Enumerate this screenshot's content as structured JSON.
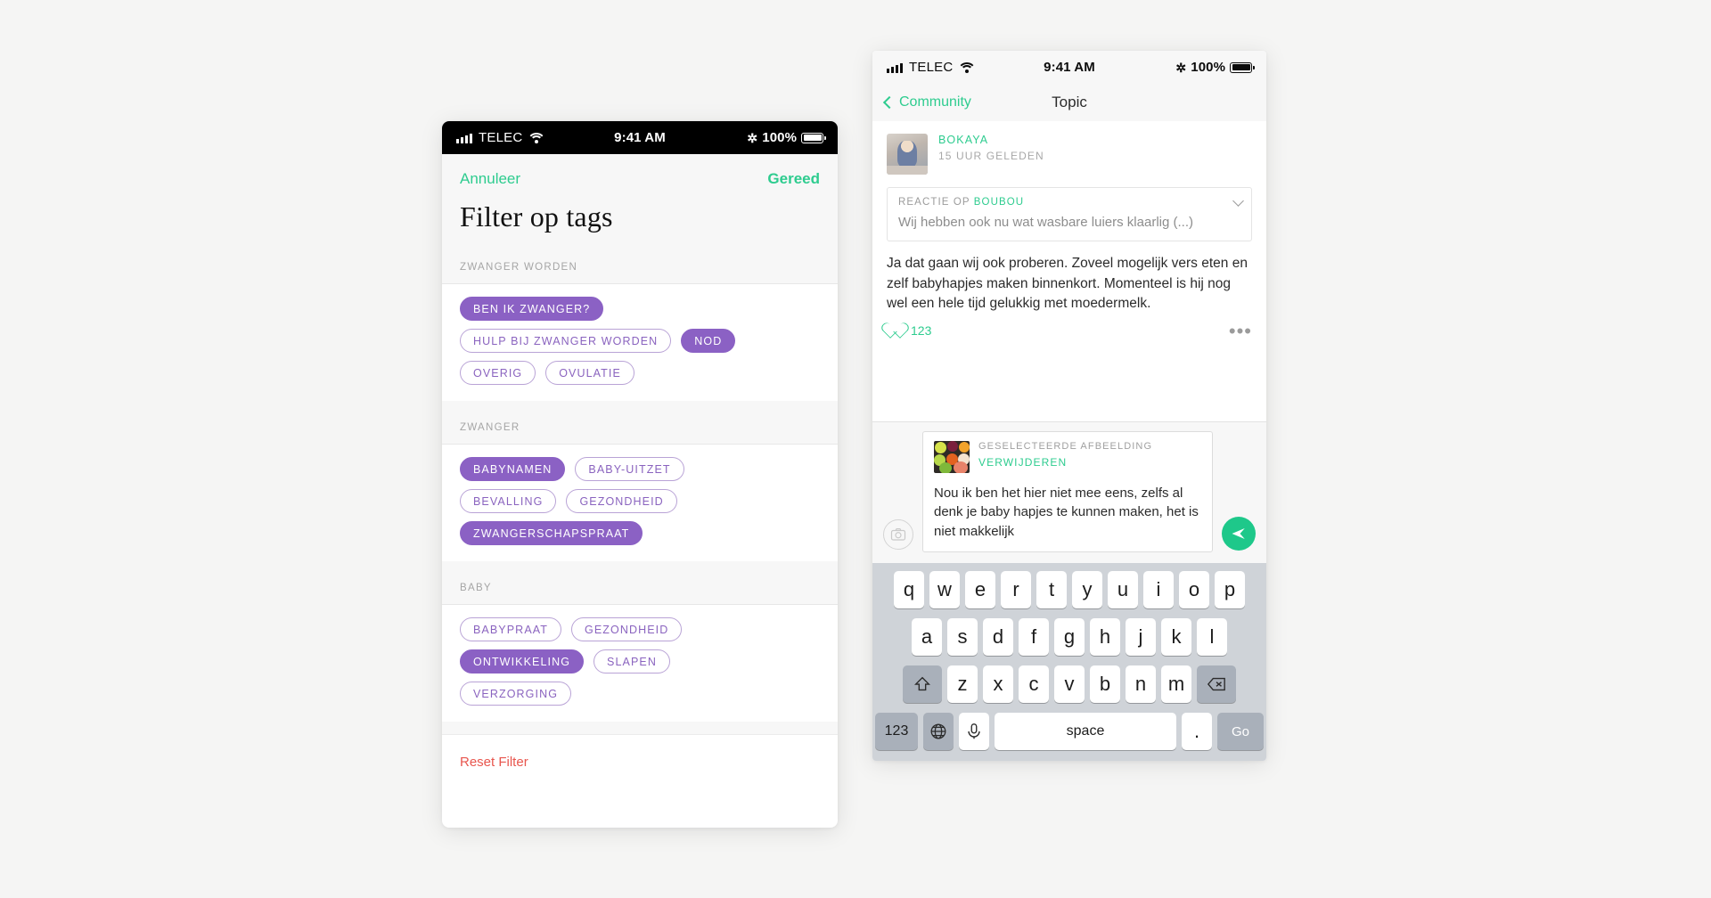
{
  "canvas": {
    "background": "#f5f5f4"
  },
  "colors": {
    "green": "#2ecc8f",
    "purple": "#8b61c4",
    "purple_outline": "#8a63bf",
    "red": "#e8564e",
    "keyboard_bg": "#cfd3d8"
  },
  "left_phone": {
    "status_bar": {
      "carrier": "TELEC",
      "time": "9:41 AM",
      "battery": "100%",
      "signal_icon": "signal-bars-icon",
      "wifi_icon": "wifi-icon",
      "bluetooth_icon": "bluetooth-icon",
      "battery_icon": "battery-full-icon"
    },
    "modal": {
      "cancel_label": "Annuleer",
      "done_label": "Gereed",
      "title": "Filter op tags",
      "reset_label": "Reset Filter"
    },
    "sections": [
      {
        "heading": "ZWANGER WORDEN",
        "tags": [
          {
            "label": "BEN IK ZWANGER?",
            "selected": true
          },
          {
            "label": "HULP BIJ ZWANGER WORDEN",
            "selected": false
          },
          {
            "label": "NOD",
            "selected": true
          },
          {
            "label": "OVERIG",
            "selected": false
          },
          {
            "label": "OVULATIE",
            "selected": false
          }
        ]
      },
      {
        "heading": "ZWANGER",
        "tags": [
          {
            "label": "BABYNAMEN",
            "selected": true
          },
          {
            "label": "BABY-UITZET",
            "selected": false
          },
          {
            "label": "BEVALLING",
            "selected": false
          },
          {
            "label": "GEZONDHEID",
            "selected": false
          },
          {
            "label": "ZWANGERSCHAPSPRAAT",
            "selected": true
          }
        ]
      },
      {
        "heading": "BABY",
        "tags": [
          {
            "label": "BABYPRAAT",
            "selected": false
          },
          {
            "label": "GEZONDHEID",
            "selected": false
          },
          {
            "label": "ONTWIKKELING",
            "selected": true
          },
          {
            "label": "SLAPEN",
            "selected": false
          },
          {
            "label": "VERZORGING",
            "selected": false
          }
        ]
      }
    ]
  },
  "right_phone": {
    "status_bar": {
      "carrier": "TELEC",
      "time": "9:41 AM",
      "battery": "100%"
    },
    "nav": {
      "back_label": "Community",
      "title": "Topic",
      "back_icon": "chevron-left-icon"
    },
    "post": {
      "author": "BOKAYA",
      "timestamp": "15 UUR GELEDEN",
      "avatar_icon": "avatar",
      "quote": {
        "prefix": "REACTIE OP",
        "author": "BOUBOU",
        "text": "Wij hebben ook nu wat wasbare luiers klaarlig (...)",
        "expand_icon": "chevron-down-icon"
      },
      "body": "Ja dat gaan wij ook proberen. Zoveel mogelijk vers eten en zelf babyhapjes maken binnenkort. Momenteel is hij nog wel een hele tijd gelukkig met moedermelk.",
      "like_count": "123",
      "like_icon": "heart-icon",
      "more_icon": "ellipsis-icon"
    },
    "compose": {
      "camera_icon": "camera-icon",
      "send_icon": "send-icon",
      "selected_image_label": "GESELECTEERDE AFBEELDING",
      "remove_label": "VERWIJDEREN",
      "thumbnail_icon": "fruit-photo-thumbnail",
      "draft_text": "Nou ik ben het hier niet mee eens, zelfs al denk je baby hapjes te kunnen maken, het is niet makkelijk"
    },
    "keyboard": {
      "row1": [
        "q",
        "w",
        "e",
        "r",
        "t",
        "y",
        "u",
        "i",
        "o",
        "p"
      ],
      "row2": [
        "a",
        "s",
        "d",
        "f",
        "g",
        "h",
        "j",
        "k",
        "l"
      ],
      "row3": [
        "z",
        "x",
        "c",
        "v",
        "b",
        "n",
        "m"
      ],
      "shift_icon": "shift-icon",
      "backspace_icon": "backspace-icon",
      "numbers_label": "123",
      "globe_icon": "globe-icon",
      "mic_icon": "microphone-icon",
      "space_label": "space",
      "period_label": ".",
      "go_label": "Go"
    }
  }
}
